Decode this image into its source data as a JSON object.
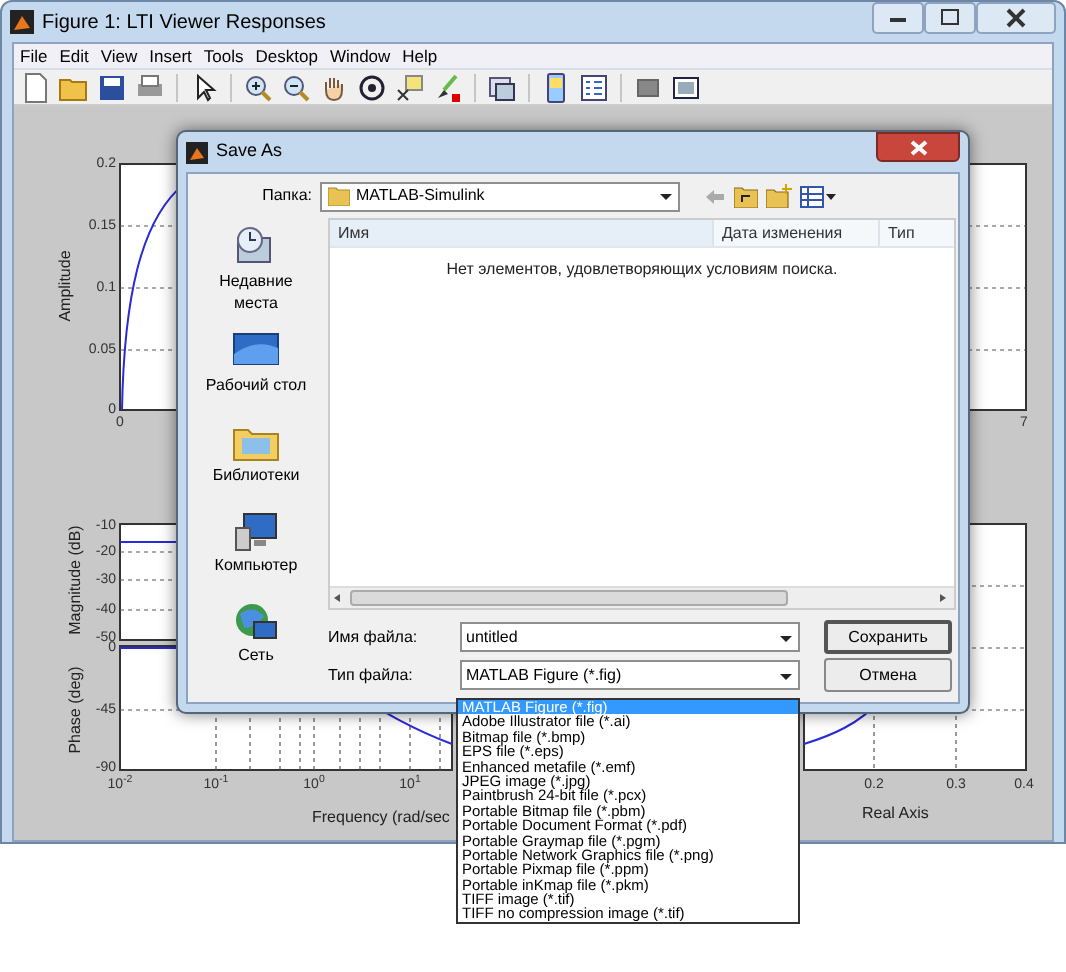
{
  "window": {
    "title": "Figure 1: LTI Viewer Responses"
  },
  "menu": [
    "File",
    "Edit",
    "View",
    "Insert",
    "Tools",
    "Desktop",
    "Window",
    "Help"
  ],
  "plots": {
    "step": {
      "ylabel": "Amplitude",
      "yticks": [
        "0.2",
        "0.15",
        "0.1",
        "0.05",
        "0"
      ],
      "xticks": [
        "0",
        "7"
      ]
    },
    "bode": {
      "magnitude_label": "Magnitude (dB)",
      "magnitude_ticks": [
        "-10",
        "-20",
        "-30",
        "-40",
        "-50"
      ],
      "phase_label": "Phase (deg)",
      "phase_ticks": [
        "0",
        "-45",
        "-90"
      ],
      "xticks": [
        "10$^{-2}$",
        "10$^{-1}$",
        "10$^{0}$",
        "10$^{1}$"
      ],
      "xlabel": "Frequency  (rad/sec"
    },
    "nyquist": {
      "xticks": [
        "0.2",
        "0.3",
        "0.4"
      ],
      "xlabel": "Real Axis"
    }
  },
  "dialog": {
    "title": "Save As",
    "folder_label": "Папка:",
    "folder": "MATLAB-Simulink",
    "places": [
      {
        "kind": "recent",
        "label": "Недавние места"
      },
      {
        "kind": "desktop",
        "label": "Рабочий стол"
      },
      {
        "kind": "libraries",
        "label": "Библиотеки"
      },
      {
        "kind": "computer",
        "label": "Компьютер"
      },
      {
        "kind": "network",
        "label": "Сеть"
      }
    ],
    "columns": [
      "Имя",
      "Дата изменения",
      "Тип"
    ],
    "empty_message": "Нет элементов, удовлетворяющих условиям поиска.",
    "file_name_label": "Имя файла:",
    "file_name": "untitled",
    "file_type_label": "Тип файла:",
    "file_type": "MATLAB Figure (*.fig)",
    "buttons": [
      "Сохранить",
      "Отмена"
    ],
    "file_types": [
      {
        "label": "MATLAB Figure (*.fig)",
        "selected": true
      },
      {
        "label": "Adobe Illustrator file (*.ai)",
        "selected": false
      },
      {
        "label": "Bitmap file (*.bmp)",
        "selected": false
      },
      {
        "label": "EPS file (*.eps)",
        "selected": false
      },
      {
        "label": "Enhanced metafile (*.emf)",
        "selected": false
      },
      {
        "label": "JPEG image (*.jpg)",
        "selected": false
      },
      {
        "label": "Paintbrush 24-bit file (*.pcx)",
        "selected": false
      },
      {
        "label": "Portable Bitmap file (*.pbm)",
        "selected": false
      },
      {
        "label": "Portable Document Format (*.pdf)",
        "selected": false
      },
      {
        "label": "Portable Graymap file (*.pgm)",
        "selected": false
      },
      {
        "label": "Portable Network Graphics file (*.png)",
        "selected": false
      },
      {
        "label": "Portable Pixmap file (*.ppm)",
        "selected": false
      },
      {
        "label": "Portable inKmap file (*.pkm)",
        "selected": false
      },
      {
        "label": "TIFF image (*.tif)",
        "selected": false
      },
      {
        "label": "TIFF no compression image (*.tif)",
        "selected": false
      }
    ]
  }
}
